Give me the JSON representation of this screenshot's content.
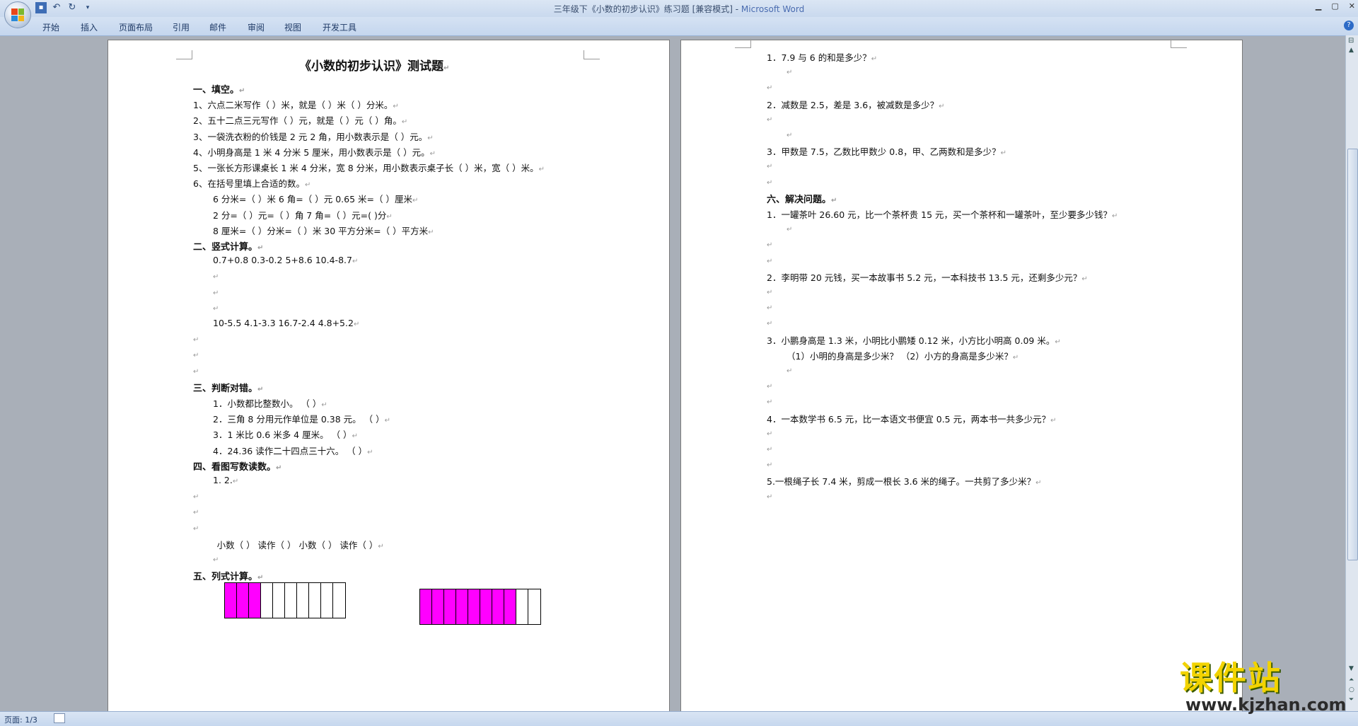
{
  "window": {
    "title": "三年级下《小数的初步认识》练习题 [兼容模式] - ",
    "app_name": "Microsoft Word"
  },
  "ribbon": {
    "tabs": [
      "开始",
      "插入",
      "页面布局",
      "引用",
      "邮件",
      "审阅",
      "视图",
      "开发工具"
    ]
  },
  "page1": {
    "title": "《小数的初步认识》测试题",
    "lines": [
      {
        "text": "一、填空。",
        "h": true
      },
      {
        "text": "1、六点二米写作（   ）米，就是（     ）米（     ）分米。"
      },
      {
        "text": "2、五十二点三元写作（     ）元，就是（     ）元（    ）角。"
      },
      {
        "text": "3、一袋洗衣粉的价钱是 2 元 2 角，用小数表示是（     ）元。"
      },
      {
        "text": "4、小明身高是 1 米 4 分米 5 厘米，用小数表示是（     ）元。"
      },
      {
        "text": "5、一张长方形课桌长 1 米 4 分米，宽 8 分米，用小数表示桌子长（    ）米，宽（    ）米。"
      },
      {
        "text": "6、在括号里填上合适的数。"
      },
      {
        "text": "6 分米=（    ）米                    6 角=（     ）元             0.65 米=（    ）厘米",
        "indent": 1
      },
      {
        "text": "2 分=（    ）元=（      ）角             7 角=（     ）元=(      )分",
        "indent": 1
      },
      {
        "text": "8 厘米=（   ）分米=（    ）米             30 平方分米=（      ）平方米",
        "indent": 1
      },
      {
        "text": "二、竖式计算。",
        "h": true
      },
      {
        "text": "0.7+0.8        0.3-0.2           5+8.6          10.4-8.7",
        "indent": 1
      },
      {
        "text": "",
        "indent": 1
      },
      {
        "text": "",
        "indent": 1
      },
      {
        "text": "",
        "indent": 1
      },
      {
        "text": "10-5.5         4.1-3.3          16.7-2.4        4.8+5.2",
        "indent": 1
      },
      {
        "text": ""
      },
      {
        "text": ""
      },
      {
        "text": ""
      },
      {
        "text": "三、判断对错。",
        "h": true
      },
      {
        "text": "1．小数都比整数小。                              （     ）",
        "indent": 1
      },
      {
        "text": "2．三角 8 分用元作单位是 0.38 元。               （     ）",
        "indent": 1
      },
      {
        "text": "3．1 米比 0.6 米多 4 厘米。                       （     ）",
        "indent": 1
      },
      {
        "text": "4．24.36 读作二十四点三十六。                     （     ）",
        "indent": 1
      },
      {
        "text": "四、看图写数读数。",
        "h": true
      },
      {
        "text": "1.                                                  2.",
        "indent": 1
      },
      {
        "text": ""
      },
      {
        "text": ""
      },
      {
        "text": ""
      },
      {
        "text": "小数（      ）     读作（        ）                         小数（     ）   读作（         ）",
        "indent": 1.2
      },
      {
        "text": "",
        "indent": 1
      },
      {
        "text": "五、列式计算。",
        "h": true
      }
    ],
    "figures": {
      "figure1": {
        "filled": 3,
        "total": 10,
        "fill_color": "#ff00ff"
      },
      "figure2": {
        "filled": 8,
        "total": 10,
        "fill_color": "#ff00ff"
      }
    }
  },
  "page2": {
    "lines": [
      {
        "text": "1．7.9 与 6 的和是多少？"
      },
      {
        "text": "",
        "indent": 1
      },
      {
        "text": ""
      },
      {
        "text": "2．减数是 2.5，差是 3.6，被减数是多少？"
      },
      {
        "text": ""
      },
      {
        "text": "",
        "indent": 1
      },
      {
        "text": "3．甲数是 7.5，乙数比甲数少 0.8，甲、乙两数和是多少？"
      },
      {
        "text": ""
      },
      {
        "text": ""
      },
      {
        "text": "六、解决问题。",
        "h": true
      },
      {
        "text": "1．一罐茶叶 26.60 元，比一个茶杯贵 15 元，买一个茶杯和一罐茶叶，至少要多少钱？"
      },
      {
        "text": "",
        "indent": 1
      },
      {
        "text": ""
      },
      {
        "text": ""
      },
      {
        "text": "2．李明带 20 元钱，买一本故事书 5.2 元，一本科技书 13.5 元，还剩多少元？"
      },
      {
        "text": ""
      },
      {
        "text": ""
      },
      {
        "text": ""
      },
      {
        "text": "3．小鹏身高是 1.3 米，小明比小鹏矮 0.12 米，小方比小明高 0.09 米。"
      },
      {
        "text": "（1）小明的身高是多少米？        （2）小方的身高是多少米？",
        "indent": 1
      },
      {
        "text": "",
        "indent": 1
      },
      {
        "text": ""
      },
      {
        "text": ""
      },
      {
        "text": "4．一本数学书 6.5 元，比一本语文书便宜 0.5 元，两本书一共多少元？"
      },
      {
        "text": ""
      },
      {
        "text": ""
      },
      {
        "text": ""
      },
      {
        "text": "5.一根绳子长 7.4 米，剪成一根长 3.6 米的绳子。一共剪了多少米？"
      },
      {
        "text": ""
      }
    ]
  },
  "status": {
    "page": "页面: 1/3"
  },
  "watermark": {
    "line1": "课件站",
    "line2": "www.kjzhan.com"
  },
  "paragraph_mark": "↵"
}
